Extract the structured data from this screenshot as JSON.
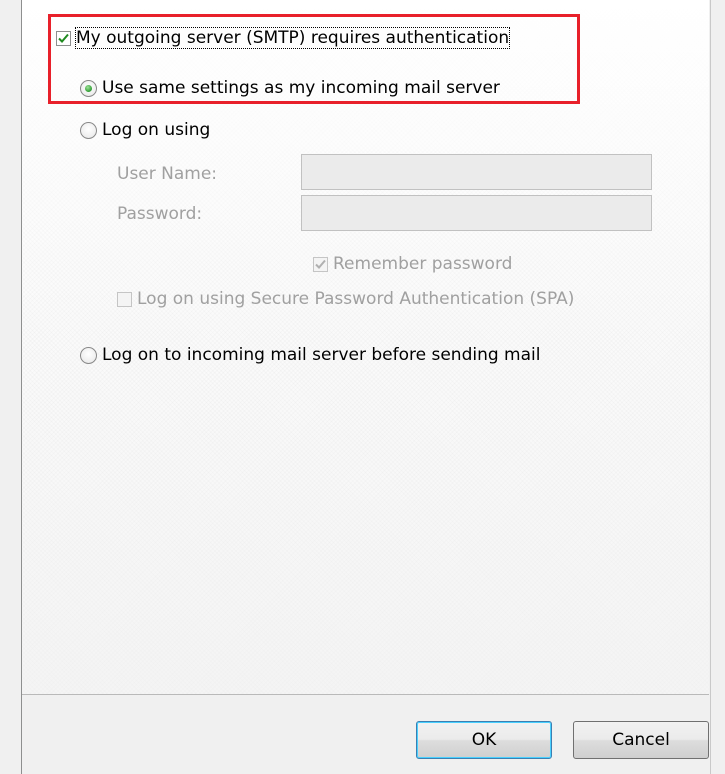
{
  "smtp_auth": {
    "requires_auth_label": "My outgoing server (SMTP) requires authentication",
    "requires_auth_checked": true
  },
  "options": {
    "same_settings_label": "Use same settings as my incoming mail server",
    "log_on_using_label": "Log on using",
    "user_name_label": "User Name:",
    "password_label": "Password:",
    "user_name_value": "",
    "password_value": "",
    "remember_password_label": "Remember password",
    "remember_password_checked": true,
    "spa_label": "Log on using Secure Password Authentication (SPA)",
    "spa_checked": false,
    "incoming_first_label": "Log on to incoming mail server before sending mail",
    "selected_option": "same_settings"
  },
  "buttons": {
    "ok_label": "OK",
    "cancel_label": "Cancel"
  },
  "colors": {
    "highlight": "#e8202a",
    "disabled_text": "#a0a0a0",
    "check_mark": "#1f8a1f"
  }
}
